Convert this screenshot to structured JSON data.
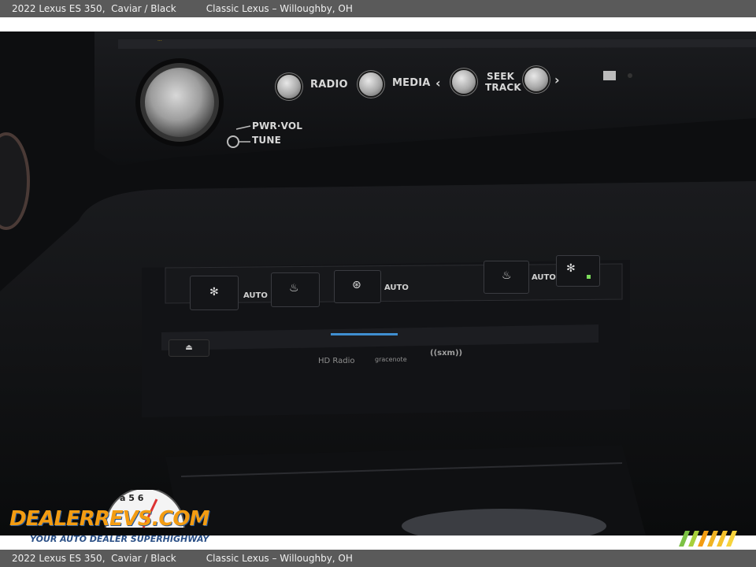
{
  "caption": {
    "title": "2022 Lexus ES 350,",
    "color": "Caviar / Black",
    "dealer": "Classic Lexus – Willoughby, OH"
  },
  "controls": {
    "knob_label_1": "PWR·VOL",
    "knob_label_2": "TUNE",
    "radio": "RADIO",
    "media": "MEDIA",
    "seek": "SEEK",
    "track": "TRACK",
    "auto_left": "AUTO",
    "auto_center": "AUTO",
    "auto_right": "AUTO",
    "hdradio": "HD Radio",
    "gracenote": "gracenote",
    "sxm": "((sxm))"
  },
  "watermark": {
    "logo": "DEALERREVS.COM",
    "tagline": "YOUR AUTO DEALER SUPERHIGHWAY",
    "dial_digits": "a 5 6"
  },
  "colors": {
    "caption_bg": "#5a5a5a",
    "logo_orange": "#f39c12",
    "logo_blue": "#2a4f86"
  }
}
